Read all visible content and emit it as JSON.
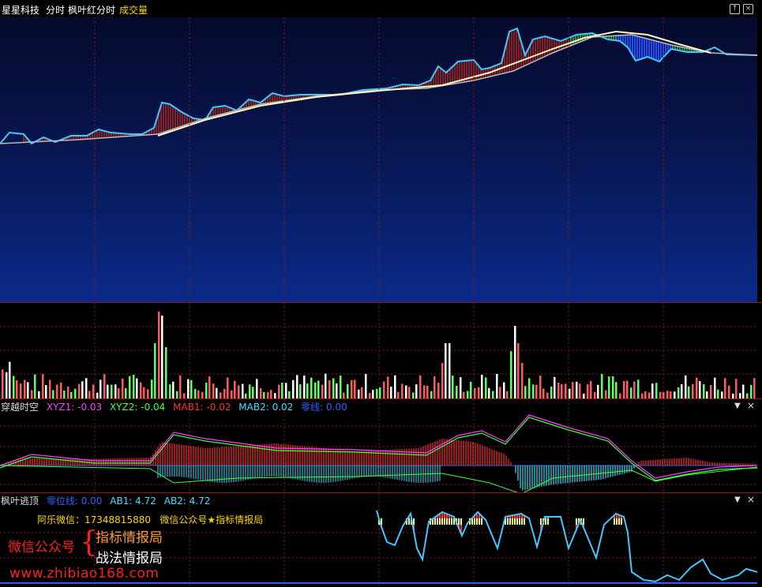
{
  "header": {
    "stock_name": "星星科技",
    "period": "分时",
    "indicator": "枫叶红分时",
    "sub_indicator": "成交量",
    "icons": [
      "zoom-icon",
      "close-icon"
    ]
  },
  "panel_xyz": {
    "name": "穿越时空",
    "labels": {
      "xyz1": "XYZ1: -0.03",
      "xyz2": "XYZ2: -0.04",
      "mab1": "MAB1: -0.02",
      "mab2": "MAB2: 0.02",
      "zero": "零线: 0.00"
    }
  },
  "panel_escape": {
    "name": "枫叶逃顶",
    "labels": {
      "zero": "零位线: 0.00",
      "ab1": "AB1: 4.72",
      "ab2": "AB2: 4.72"
    },
    "contact": "阿乐微信：17348815880   微信公众号★指标情报局",
    "wechat_label": "微信公众号",
    "bracket": "{",
    "pub1": "指标情报局",
    "pub2": "战法情报局",
    "website": "www.zhibiao168.com"
  },
  "colors": {
    "header_text": "#ffffff",
    "header_accent": "#ffd700",
    "xyz1": "#ff40ff",
    "xyz2": "#40ff40",
    "mab1": "#ff3030",
    "mab2": "#40e0ff",
    "zero": "#3060ff",
    "watermark": "#ff2020",
    "pub": "#ff9933"
  }
}
